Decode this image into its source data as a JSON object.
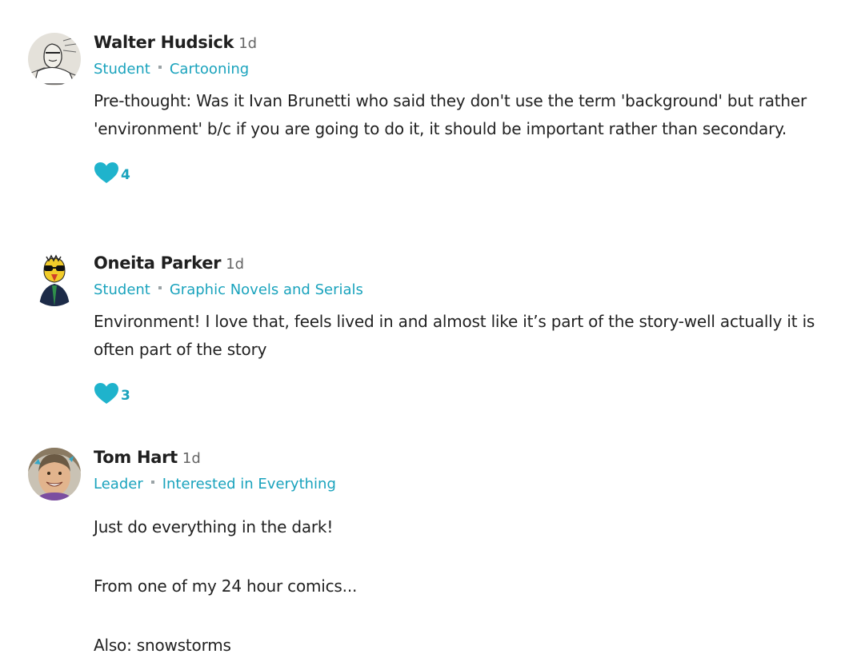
{
  "comments": [
    {
      "author": "Walter Hudsick",
      "age": "1d",
      "role": "Student",
      "group": "Cartooning",
      "paragraphs": [
        "Pre-thought:  Was it Ivan Brunetti who said they don't use the term 'background' but rather 'environment' b/c if you are going to do it, it should be important rather than secondary."
      ],
      "like_count": "4",
      "avatar_icon": "sketch-portrait-avatar"
    },
    {
      "author": "Oneita Parker",
      "age": "1d",
      "role": "Student",
      "group": "Graphic Novels and Serials",
      "paragraphs": [
        "Environment! I love that, feels lived in and almost like it’s part of the story-well actually it is often part of the story"
      ],
      "like_count": "3",
      "avatar_icon": "cartoon-bird-avatar"
    },
    {
      "author": "Tom Hart",
      "age": "1d",
      "role": "Leader",
      "group": "Interested in Everything",
      "paragraphs": [
        "Just do everything in the dark!",
        "From one of my 24 hour comics...",
        "Also: snowstorms"
      ],
      "avatar_icon": "photo-avatar"
    }
  ],
  "colors": {
    "accent": "#1aa3bd",
    "heart": "#1fb3cc",
    "text": "#222222",
    "muted": "#666666"
  }
}
